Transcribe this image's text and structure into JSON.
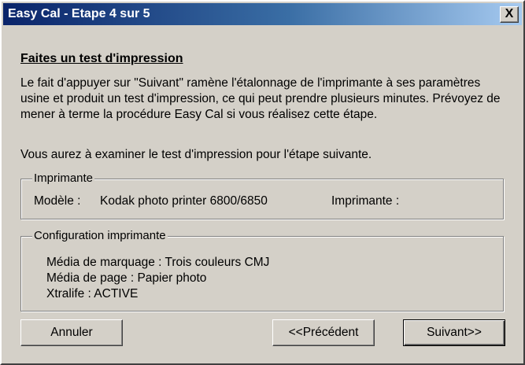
{
  "window": {
    "title": "Easy Cal - Etape 4 sur 5",
    "close_label": "X"
  },
  "content": {
    "heading": "Faites un test d'impression",
    "paragraph1": "Le fait d'appuyer sur \"Suivant\" ramène l'étalonnage de l'imprimante à ses paramètres usine et produit un test d'impression, ce qui peut prendre plusieurs minutes. Prévoyez de mener à terme la procédure Easy Cal si vous réalisez cette étape.",
    "paragraph2": "Vous aurez à examiner le test d'impression pour l'étape suivante."
  },
  "printer_group": {
    "legend": "Imprimante",
    "model_label": "Modèle :",
    "model_value": "Kodak photo printer 6800/6850",
    "printer_label": "Imprimante :",
    "printer_value": ""
  },
  "config_group": {
    "legend": "Configuration imprimante",
    "lines": [
      "Média de marquage : Trois couleurs CMJ",
      "Média de page : Papier photo",
      "Xtralife : ACTIVE"
    ]
  },
  "buttons": {
    "cancel": "Annuler",
    "previous": "<<Précédent",
    "next": "Suivant>>"
  }
}
